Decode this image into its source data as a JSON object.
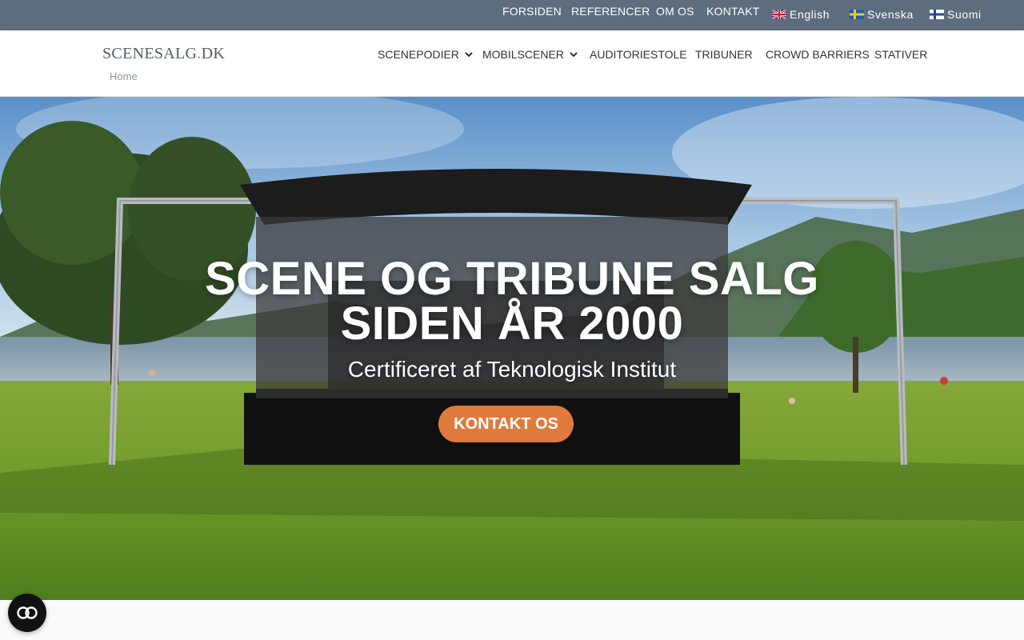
{
  "topbar": {
    "links": [
      "FORSIDEN",
      "REFERENCER",
      "OM OS",
      "KONTAKT"
    ],
    "languages": [
      {
        "label": "English",
        "flag": "uk-flag-icon"
      },
      {
        "label": "Svenska",
        "flag": "sweden-flag-icon"
      },
      {
        "label": "Suomi",
        "flag": "finland-flag-icon"
      }
    ]
  },
  "header": {
    "logo_main": "SCENESALG",
    "logo_dot": ".",
    "logo_tld": "DK",
    "breadcrumb": "Home",
    "nav": [
      {
        "label": "SCENEPODIER",
        "has_dropdown": true
      },
      {
        "label": "MOBILSCENER",
        "has_dropdown": true
      },
      {
        "label": "AUDITORIESTOLE",
        "has_dropdown": false
      },
      {
        "label": "TRIBUNER",
        "has_dropdown": false
      },
      {
        "label": "CROWD BARRIERS",
        "has_dropdown": false
      },
      {
        "label": "STATIVER",
        "has_dropdown": false
      }
    ]
  },
  "hero": {
    "title_line1": "SCENE OG TRIBUNE SALG",
    "title_line2": "SIDEN ÅR 2000",
    "subtitle": "Certificeret af Teknologisk Institut",
    "cta_label": "KONTAKT OS"
  },
  "colors": {
    "topbar": "#5d6d7e",
    "accent": "#e07a3c"
  },
  "accessibility": {
    "icon": "accessibility-toggle-icon"
  }
}
